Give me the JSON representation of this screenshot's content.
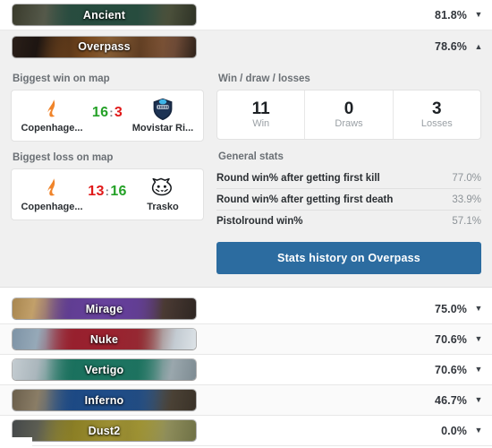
{
  "maps": [
    {
      "name": "Ancient",
      "winrate": "81.8%",
      "caret": "▼",
      "caret_name": "chevron-down-icon",
      "expanded": false,
      "banner_left": "#3a3b2c",
      "banner_mid": "#2f5046",
      "banner_right": "#4a4f3a"
    },
    {
      "name": "Overpass",
      "winrate": "78.6%",
      "caret": "▲",
      "caret_name": "chevron-up-icon",
      "expanded": true,
      "banner_left": "#2a1f19",
      "banner_mid": "#b4691f",
      "banner_right": "#6d4a36"
    },
    {
      "name": "Mirage",
      "winrate": "75.0%",
      "caret": "▼",
      "caret_name": "chevron-down-icon",
      "expanded": false,
      "banner_left": "#9a7c52",
      "banner_mid": "#6b3fa0",
      "banner_right": "#4a3a33"
    },
    {
      "name": "Nuke",
      "winrate": "70.6%",
      "caret": "▼",
      "caret_name": "chevron-down-icon",
      "expanded": false,
      "banner_left": "#8ea3b4",
      "banner_mid": "#a3212f",
      "banner_right": "#c3cbd2"
    },
    {
      "name": "Vertigo",
      "winrate": "70.6%",
      "caret": "▼",
      "caret_name": "chevron-down-icon",
      "expanded": false,
      "banner_left": "#b9c3c8",
      "banner_mid": "#1f7a62",
      "banner_right": "#9aa7ad"
    },
    {
      "name": "Inferno",
      "winrate": "46.7%",
      "caret": "▼",
      "caret_name": "chevron-down-icon",
      "expanded": false,
      "banner_left": "#5b5142",
      "banner_mid": "#1f4e8c",
      "banner_right": "#4a4135"
    },
    {
      "name": "Dust2",
      "winrate": "0.0%",
      "caret": "▼",
      "caret_name": "chevron-down-icon",
      "expanded": false,
      "banner_left": "#4a4b48",
      "banner_mid": "#a99a27",
      "banner_right": "#8d8c5a"
    }
  ],
  "panel": {
    "biggest_win": {
      "title": "Biggest win on map",
      "team_left": "Copenhage...",
      "team_right": "Movistar Ri...",
      "score_left": "16",
      "score_sep": ":",
      "score_right": "3",
      "left_result": "win",
      "right_result": "loss"
    },
    "biggest_loss": {
      "title": "Biggest loss on map",
      "team_left": "Copenhage...",
      "team_right": "Trasko",
      "score_left": "13",
      "score_sep": ":",
      "score_right": "16",
      "left_result": "loss",
      "right_result": "win"
    },
    "wdl": {
      "title": "Win / draw / losses",
      "cells": [
        {
          "num": "11",
          "cap": "Win"
        },
        {
          "num": "0",
          "cap": "Draws"
        },
        {
          "num": "3",
          "cap": "Losses"
        }
      ]
    },
    "general_stats": {
      "title": "General stats",
      "rows": [
        {
          "label": "Round win% after getting first kill",
          "value": "77.0%"
        },
        {
          "label": "Round win% after getting first death",
          "value": "33.9%"
        },
        {
          "label": "Pistolround win%",
          "value": "57.1%"
        }
      ]
    },
    "history_button": "Stats history on Overpass",
    "button_color": "#2c6ca0"
  }
}
